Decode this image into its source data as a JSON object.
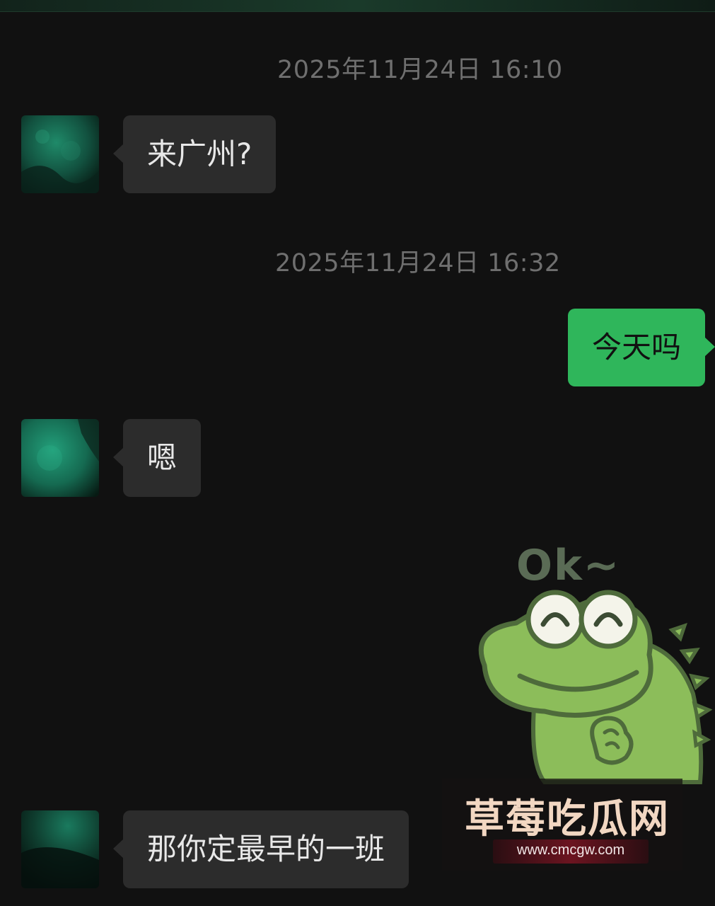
{
  "messages": [
    {
      "kind": "timestamp",
      "text": "2025年11月24日 16:10"
    },
    {
      "kind": "incoming",
      "text": "来广州?"
    },
    {
      "kind": "timestamp",
      "text": "2025年11月24日 16:32"
    },
    {
      "kind": "outgoing",
      "text": "今天吗"
    },
    {
      "kind": "incoming",
      "text": "嗯"
    },
    {
      "kind": "sticker",
      "text": "Ok~",
      "icon": "frog-sticker-icon"
    },
    {
      "kind": "incoming",
      "text": "那你定最早的一班"
    }
  ],
  "watermark": {
    "title": "草莓吃瓜网",
    "url": "www.cmcgw.com"
  },
  "colors": {
    "background": "#111111",
    "incoming_bubble": "#2c2c2c",
    "outgoing_bubble": "#2fb65b",
    "timestamp_text": "#6f6f6f",
    "avatar_accent": "#1c7a5c",
    "sticker_green": "#8cbd5a"
  }
}
